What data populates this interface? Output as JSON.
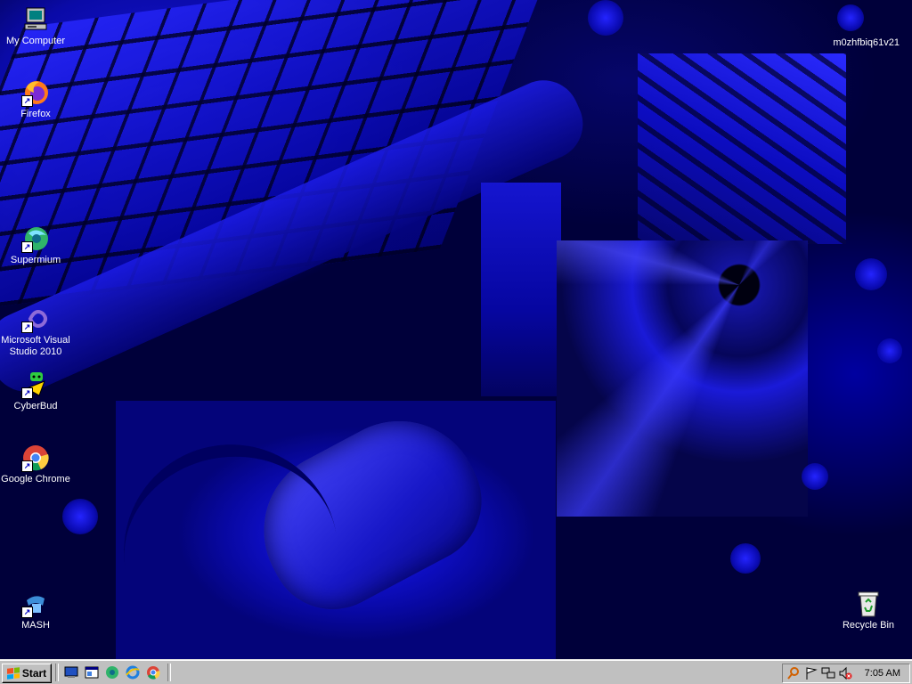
{
  "desktop": {
    "icons": [
      {
        "label": "My Computer",
        "icon": "computer-icon"
      },
      {
        "label": "Firefox",
        "icon": "firefox-icon"
      },
      {
        "label": "Supermium",
        "icon": "supermium-icon"
      },
      {
        "label": "Microsoft Visual Studio 2010",
        "icon": "visual-studio-icon"
      },
      {
        "label": "CyberBud",
        "icon": "cyberbud-icon"
      },
      {
        "label": "Google Chrome",
        "icon": "chrome-icon"
      },
      {
        "label": "MASH",
        "icon": "mash-icon"
      },
      {
        "label": "Recycle Bin",
        "icon": "recycle-bin-icon"
      }
    ],
    "hostname": "m0zhfbiq61v21"
  },
  "taskbar": {
    "start_label": "Start",
    "quick_launch": [
      "show-desktop-icon",
      "explorer-icon",
      "supermium-icon",
      "internet-explorer-icon",
      "chrome-icon"
    ],
    "tray": [
      "search-icon",
      "flag-icon",
      "network-icon",
      "volume-muted-icon"
    ],
    "clock": "7:05 AM"
  },
  "colors": {
    "taskbar": "#c0c0c0",
    "wallpaper": "#0000c0"
  }
}
